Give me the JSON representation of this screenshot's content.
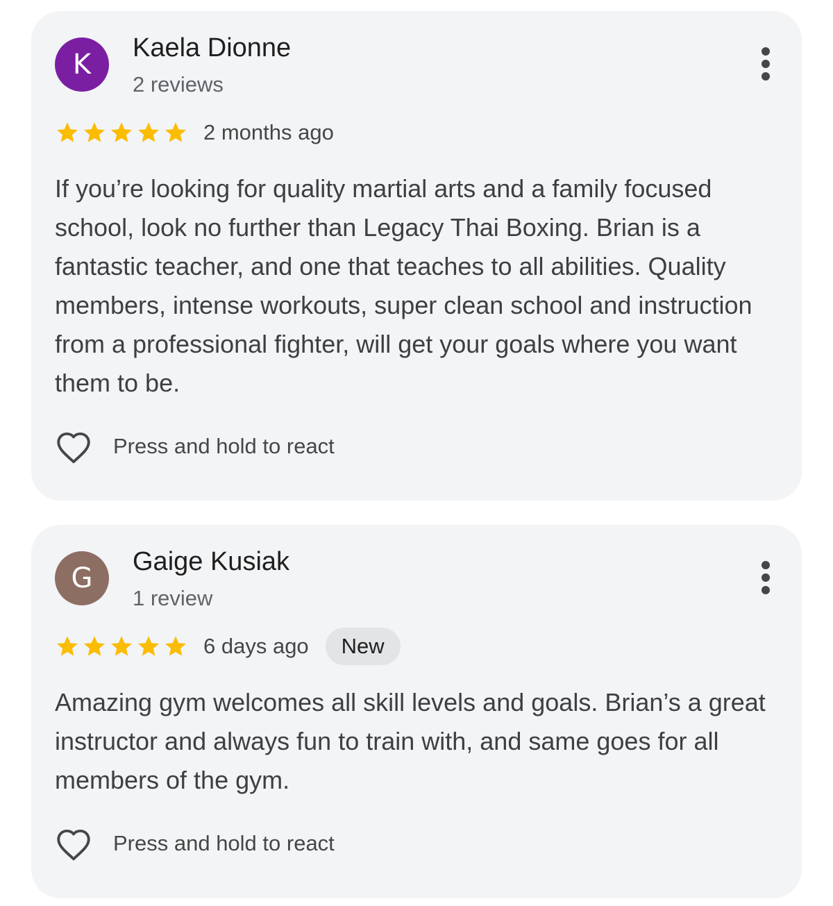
{
  "colors": {
    "card_background": "#f3f4f6",
    "star": "#fbbc04",
    "avatar_kaela": "#7b1fa2",
    "avatar_gaige": "#8d6e63",
    "badge_background": "#e3e4e6"
  },
  "reviews": [
    {
      "avatar_letter": "K",
      "avatar_color": "#7b1fa2",
      "name": "Kaela Dionne",
      "review_count": "2 reviews",
      "rating": 5,
      "max_rating": 5,
      "date": "2 months ago",
      "badge": "",
      "text": "If you’re looking for quality martial arts and a family focused school, look no further than Legacy Thai Boxing. Brian is a fantastic teacher, and one that teaches to all abilities. Quality members, intense workouts, super clean school and instruction from a professional fighter, will get your goals where you want them to be.",
      "react_label": "Press and hold to react",
      "react_icon": "heart-outline-icon",
      "menu_icon": "more-vert-icon"
    },
    {
      "avatar_letter": "G",
      "avatar_color": "#8d6e63",
      "name": "Gaige Kusiak",
      "review_count": "1 review",
      "rating": 5,
      "max_rating": 5,
      "date": "6 days ago",
      "badge": "New",
      "text": "Amazing gym welcomes all skill levels and goals. Brian’s a great instructor and always fun to train with, and same goes for all members of the gym.",
      "react_label": "Press and hold to react",
      "react_icon": "heart-outline-icon",
      "menu_icon": "more-vert-icon"
    }
  ]
}
